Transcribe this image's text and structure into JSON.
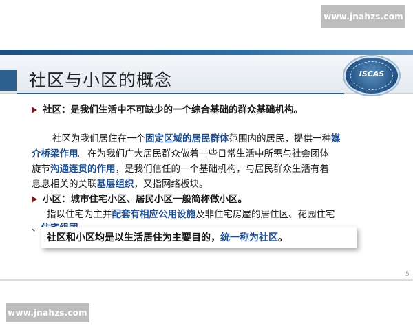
{
  "watermark": {
    "top": "www.jnahzs.com",
    "bottom": "www.jnahzs.com"
  },
  "slide": {
    "title": "社区与小区的概念",
    "logo_text": "ISCAS",
    "page_number": "5",
    "bullet1": {
      "term": "社区：",
      "text": "是我们生活中不可缺少的一个综合基础的群众基础机构。"
    },
    "para1": {
      "l1_a": "社区为我们居住在一个",
      "l1_hl": "固定区域的居民群体",
      "l1_b": "范围内的居民，提供一种",
      "l1_hl2": "媒",
      "l2_hl": "介桥梁作用",
      "l2_a": "。在为我们广大居民群众做着一些日常生活中所需与社会团体",
      "l3_a": "旋节",
      "l3_hl": "沟通连贯的作用",
      "l3_b": "，是我们信任的一个基础机构，与居民群众生活有着",
      "l4_a": "息息相关的关联",
      "l4_hl": "基层组织",
      "l4_b": "，又指网络板块。"
    },
    "bullet2": {
      "text": "小区：城市住宅小区、居民小区一般简称做小区。"
    },
    "para2": {
      "l1_a": "指以住宅为主并",
      "l1_hl": "配套有相应公用设施",
      "l1_b": "及非住宅房屋的居住区、花园住宅",
      "l2_a": "、",
      "l2_hl": "住宅组团",
      "l2_b": "。"
    },
    "callout": {
      "a": "社区和小区均是以生活居住为主要目的，",
      "hl": "统一称为社区",
      "b": "。"
    }
  }
}
